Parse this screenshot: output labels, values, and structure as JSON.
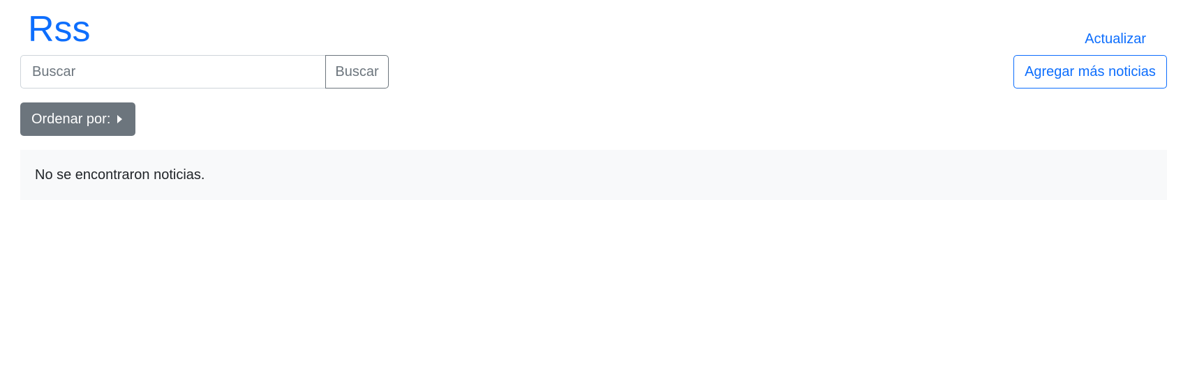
{
  "header": {
    "brand": "Rss",
    "refresh_label": "Actualizar"
  },
  "search": {
    "placeholder": "Buscar",
    "value": "",
    "button_label": "Buscar"
  },
  "actions": {
    "add_label": "Agregar más noticias"
  },
  "sort": {
    "label": "Ordenar por:",
    "icon": "caret-right-icon"
  },
  "results": {
    "empty_message": "No se encontraron noticias."
  },
  "colors": {
    "primary": "#0d6efd",
    "secondary": "#6c757d",
    "panel_bg": "#f8f9fa"
  }
}
